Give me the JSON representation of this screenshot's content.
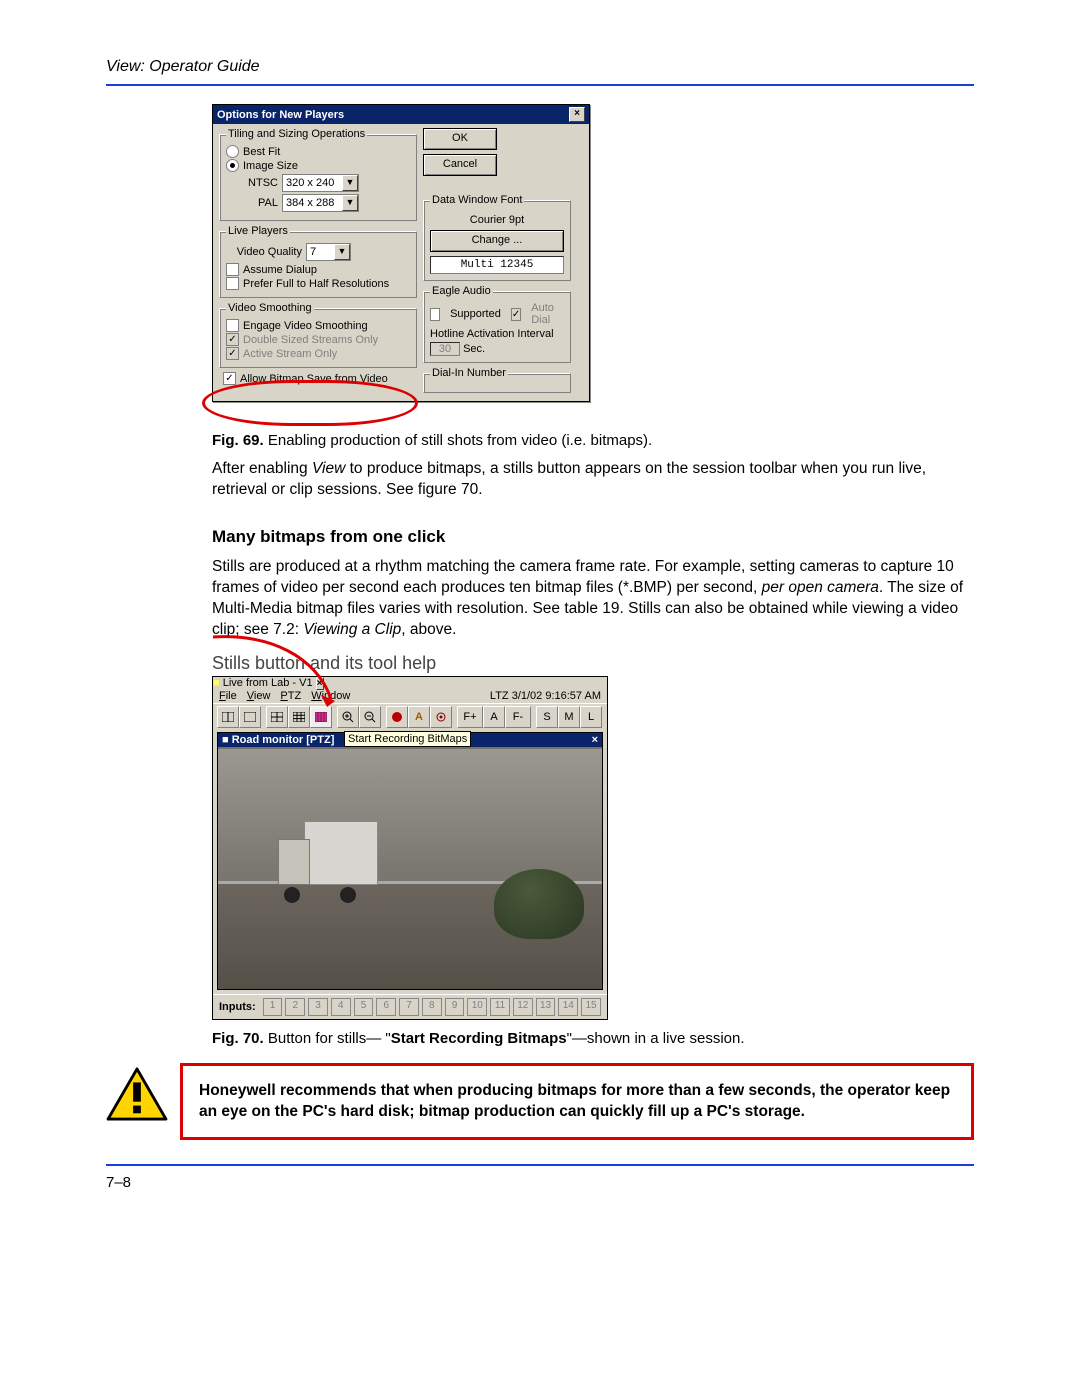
{
  "header": "View: Operator Guide",
  "dialog1": {
    "title": "Options for New Players",
    "ok": "OK",
    "cancel": "Cancel",
    "groups": {
      "tiling": {
        "legend": "Tiling and Sizing Operations",
        "bestfit": "Best Fit",
        "imagesize": "Image Size",
        "ntsc_label": "NTSC",
        "ntsc_val": "320 x 240",
        "pal_label": "PAL",
        "pal_val": "384 x 288"
      },
      "live": {
        "legend": "Live Players",
        "quality_label": "Video Quality",
        "quality_val": "7",
        "dialup": "Assume Dialup",
        "fullhalf": "Prefer Full to Half Resolutions"
      },
      "smoothing": {
        "legend": "Video Smoothing",
        "engage": "Engage Video Smoothing",
        "double": "Double Sized Streams Only",
        "active": "Active Stream Only"
      },
      "font": {
        "legend": "Data Window Font",
        "name": "Courier 9pt",
        "change": "Change ...",
        "multi": "Multi 12345"
      },
      "eagle": {
        "legend": "Eagle Audio",
        "supported": "Supported",
        "autodial": "Auto Dial",
        "hotline": "Hotline Activation Interval",
        "interval": "30",
        "sec": "Sec."
      },
      "dialin": {
        "legend": "Dial-In Number"
      },
      "allowbitmap": "Allow Bitmap Save from Video"
    }
  },
  "fig69": {
    "label": "Fig. 69.",
    "text": " Enabling production of still shots from video (i.e. bitmaps)."
  },
  "para1a": "After enabling ",
  "para1b": "View",
  "para1c": " to produce bitmaps, a stills button appears on the session toolbar when you run live, retrieval or clip sessions. See figure 70.",
  "section_heading": "Many bitmaps from one click",
  "para2a": "Stills are produced at a rhythm matching the camera frame rate. For example, setting cameras to capture 10 frames of video per second each produces ten bitmap files (*.BMP) per second, ",
  "para2b": "per open camera",
  "para2c": ". The size of Multi-Media bitmap files varies with resolution. See table ",
  "para2d": "19",
  "para2e": ". Stills can also be obtained while viewing a video clip; see 7.2: ",
  "para2f": "Viewing a Clip",
  "para2g": ", above.",
  "stills_label": "Stills button and its tool help",
  "live": {
    "title": "Live from Lab - V1",
    "menu": {
      "file": "File",
      "view": "View",
      "ptz": "PTZ",
      "window": "Window"
    },
    "timestamp": "LTZ 3/1/02 9:16:57 AM",
    "vbar": "Road monitor [PTZ]",
    "tooltip": "Start Recording BitMaps",
    "inputs_label": "Inputs:",
    "inputs": [
      "1",
      "2",
      "3",
      "4",
      "5",
      "6",
      "7",
      "8",
      "9",
      "10",
      "11",
      "12",
      "13",
      "14",
      "15"
    ],
    "tb": {
      "fplus": "F+",
      "a": "A",
      "fminus": "F-",
      "s": "S",
      "m": "M",
      "l": "L"
    }
  },
  "fig70": {
    "label": "Fig. 70.",
    "text_a": " Button for stills— \"",
    "text_b": "Start Recording Bitmaps",
    "text_c": "\"—shown in a live session."
  },
  "warning": "Honeywell recommends that when producing bitmaps for more than a few seconds, the operator keep an eye on the PC's hard disk; bitmap production can quickly fill up a PC's storage.",
  "page_number": "7–8"
}
